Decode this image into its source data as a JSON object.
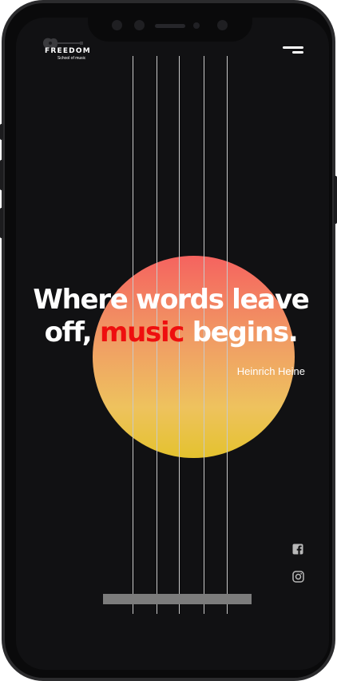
{
  "brand": {
    "name": "FREEDOM",
    "tagline": "School of music"
  },
  "hero": {
    "quote_part1": "Where words leave off,",
    "quote_highlight": "music",
    "quote_part2": "begins.",
    "author": "Heinrich Heine"
  },
  "icons": {
    "logo": "guitar-icon",
    "menu": "menu-icon",
    "social": [
      "facebook-icon",
      "instagram-icon"
    ]
  },
  "colors": {
    "background": "#111113",
    "accent": "#ee0f0f",
    "sun_top": "#f5635f",
    "sun_bottom": "#e4c22e",
    "text": "#ffffff"
  }
}
